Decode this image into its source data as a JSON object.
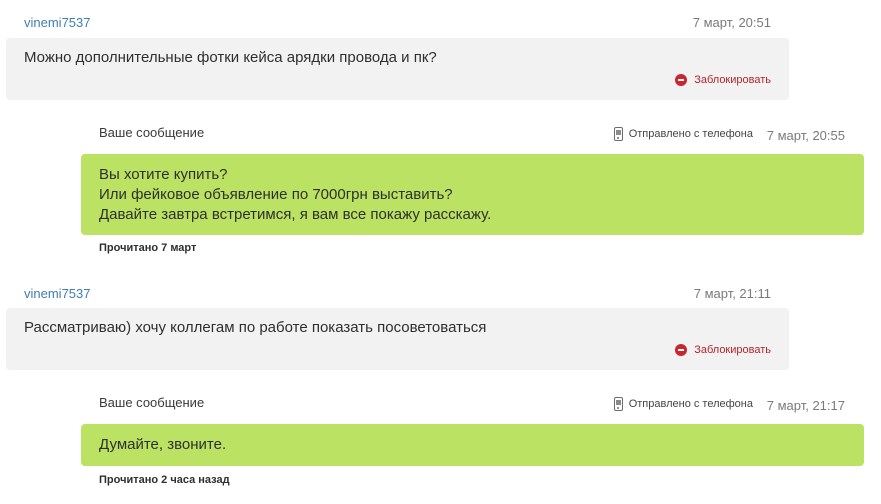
{
  "messages": [
    {
      "user": "vinemi7537",
      "time": "7 март, 20:51",
      "text": "Можно дополнительные фотки кейса арядки провода и пк?",
      "block_label": "Заблокировать"
    },
    {
      "label": "Ваше сообщение",
      "sent_from": "Отправлено с телефона",
      "time": "7 март, 20:55",
      "lines": [
        "Вы хотите купить?",
        "Или фейковое объявление по 7000грн выставить?",
        "Давайте завтра встретимся, я вам все покажу расскажу."
      ],
      "read_status": "Прочитано 7 март"
    },
    {
      "user": "vinemi7537",
      "time": "7 март, 21:11",
      "text": "Рассматриваю) хочу коллегам по работе показать посоветоваться",
      "block_label": "Заблокировать"
    },
    {
      "label": "Ваше сообщение",
      "sent_from": "Отправлено с телефона",
      "time": "7 март, 21:17",
      "lines": [
        "Думайте, звоните."
      ],
      "read_status": "Прочитано 2 часа назад"
    }
  ],
  "colors": {
    "incoming_bg": "#f2f2f2",
    "outgoing_bg": "#bbe262",
    "username": "#3f7fb5",
    "block": "#c9262f"
  },
  "icons": {
    "block": "block-icon",
    "phone": "phone-icon"
  }
}
